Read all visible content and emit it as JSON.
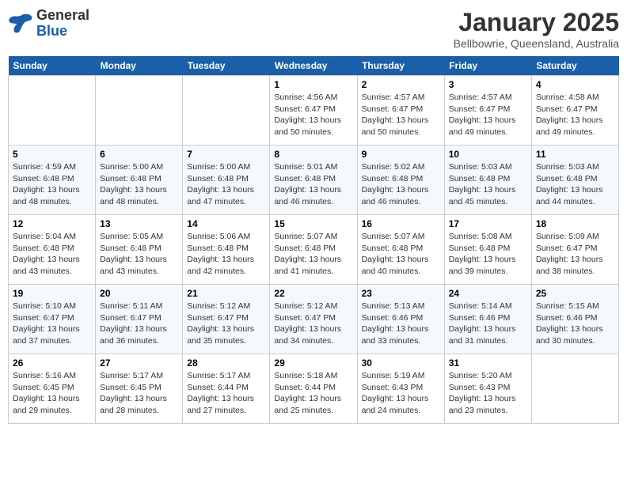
{
  "header": {
    "logo_general": "General",
    "logo_blue": "Blue",
    "title": "January 2025",
    "subtitle": "Bellbowrie, Queensland, Australia"
  },
  "weekdays": [
    "Sunday",
    "Monday",
    "Tuesday",
    "Wednesday",
    "Thursday",
    "Friday",
    "Saturday"
  ],
  "weeks": [
    [
      {
        "day": "",
        "info": ""
      },
      {
        "day": "",
        "info": ""
      },
      {
        "day": "",
        "info": ""
      },
      {
        "day": "1",
        "info": "Sunrise: 4:56 AM\nSunset: 6:47 PM\nDaylight: 13 hours\nand 50 minutes."
      },
      {
        "day": "2",
        "info": "Sunrise: 4:57 AM\nSunset: 6:47 PM\nDaylight: 13 hours\nand 50 minutes."
      },
      {
        "day": "3",
        "info": "Sunrise: 4:57 AM\nSunset: 6:47 PM\nDaylight: 13 hours\nand 49 minutes."
      },
      {
        "day": "4",
        "info": "Sunrise: 4:58 AM\nSunset: 6:47 PM\nDaylight: 13 hours\nand 49 minutes."
      }
    ],
    [
      {
        "day": "5",
        "info": "Sunrise: 4:59 AM\nSunset: 6:48 PM\nDaylight: 13 hours\nand 48 minutes."
      },
      {
        "day": "6",
        "info": "Sunrise: 5:00 AM\nSunset: 6:48 PM\nDaylight: 13 hours\nand 48 minutes."
      },
      {
        "day": "7",
        "info": "Sunrise: 5:00 AM\nSunset: 6:48 PM\nDaylight: 13 hours\nand 47 minutes."
      },
      {
        "day": "8",
        "info": "Sunrise: 5:01 AM\nSunset: 6:48 PM\nDaylight: 13 hours\nand 46 minutes."
      },
      {
        "day": "9",
        "info": "Sunrise: 5:02 AM\nSunset: 6:48 PM\nDaylight: 13 hours\nand 46 minutes."
      },
      {
        "day": "10",
        "info": "Sunrise: 5:03 AM\nSunset: 6:48 PM\nDaylight: 13 hours\nand 45 minutes."
      },
      {
        "day": "11",
        "info": "Sunrise: 5:03 AM\nSunset: 6:48 PM\nDaylight: 13 hours\nand 44 minutes."
      }
    ],
    [
      {
        "day": "12",
        "info": "Sunrise: 5:04 AM\nSunset: 6:48 PM\nDaylight: 13 hours\nand 43 minutes."
      },
      {
        "day": "13",
        "info": "Sunrise: 5:05 AM\nSunset: 6:48 PM\nDaylight: 13 hours\nand 43 minutes."
      },
      {
        "day": "14",
        "info": "Sunrise: 5:06 AM\nSunset: 6:48 PM\nDaylight: 13 hours\nand 42 minutes."
      },
      {
        "day": "15",
        "info": "Sunrise: 5:07 AM\nSunset: 6:48 PM\nDaylight: 13 hours\nand 41 minutes."
      },
      {
        "day": "16",
        "info": "Sunrise: 5:07 AM\nSunset: 6:48 PM\nDaylight: 13 hours\nand 40 minutes."
      },
      {
        "day": "17",
        "info": "Sunrise: 5:08 AM\nSunset: 6:48 PM\nDaylight: 13 hours\nand 39 minutes."
      },
      {
        "day": "18",
        "info": "Sunrise: 5:09 AM\nSunset: 6:47 PM\nDaylight: 13 hours\nand 38 minutes."
      }
    ],
    [
      {
        "day": "19",
        "info": "Sunrise: 5:10 AM\nSunset: 6:47 PM\nDaylight: 13 hours\nand 37 minutes."
      },
      {
        "day": "20",
        "info": "Sunrise: 5:11 AM\nSunset: 6:47 PM\nDaylight: 13 hours\nand 36 minutes."
      },
      {
        "day": "21",
        "info": "Sunrise: 5:12 AM\nSunset: 6:47 PM\nDaylight: 13 hours\nand 35 minutes."
      },
      {
        "day": "22",
        "info": "Sunrise: 5:12 AM\nSunset: 6:47 PM\nDaylight: 13 hours\nand 34 minutes."
      },
      {
        "day": "23",
        "info": "Sunrise: 5:13 AM\nSunset: 6:46 PM\nDaylight: 13 hours\nand 33 minutes."
      },
      {
        "day": "24",
        "info": "Sunrise: 5:14 AM\nSunset: 6:46 PM\nDaylight: 13 hours\nand 31 minutes."
      },
      {
        "day": "25",
        "info": "Sunrise: 5:15 AM\nSunset: 6:46 PM\nDaylight: 13 hours\nand 30 minutes."
      }
    ],
    [
      {
        "day": "26",
        "info": "Sunrise: 5:16 AM\nSunset: 6:45 PM\nDaylight: 13 hours\nand 29 minutes."
      },
      {
        "day": "27",
        "info": "Sunrise: 5:17 AM\nSunset: 6:45 PM\nDaylight: 13 hours\nand 28 minutes."
      },
      {
        "day": "28",
        "info": "Sunrise: 5:17 AM\nSunset: 6:44 PM\nDaylight: 13 hours\nand 27 minutes."
      },
      {
        "day": "29",
        "info": "Sunrise: 5:18 AM\nSunset: 6:44 PM\nDaylight: 13 hours\nand 25 minutes."
      },
      {
        "day": "30",
        "info": "Sunrise: 5:19 AM\nSunset: 6:43 PM\nDaylight: 13 hours\nand 24 minutes."
      },
      {
        "day": "31",
        "info": "Sunrise: 5:20 AM\nSunset: 6:43 PM\nDaylight: 13 hours\nand 23 minutes."
      },
      {
        "day": "",
        "info": ""
      }
    ]
  ]
}
